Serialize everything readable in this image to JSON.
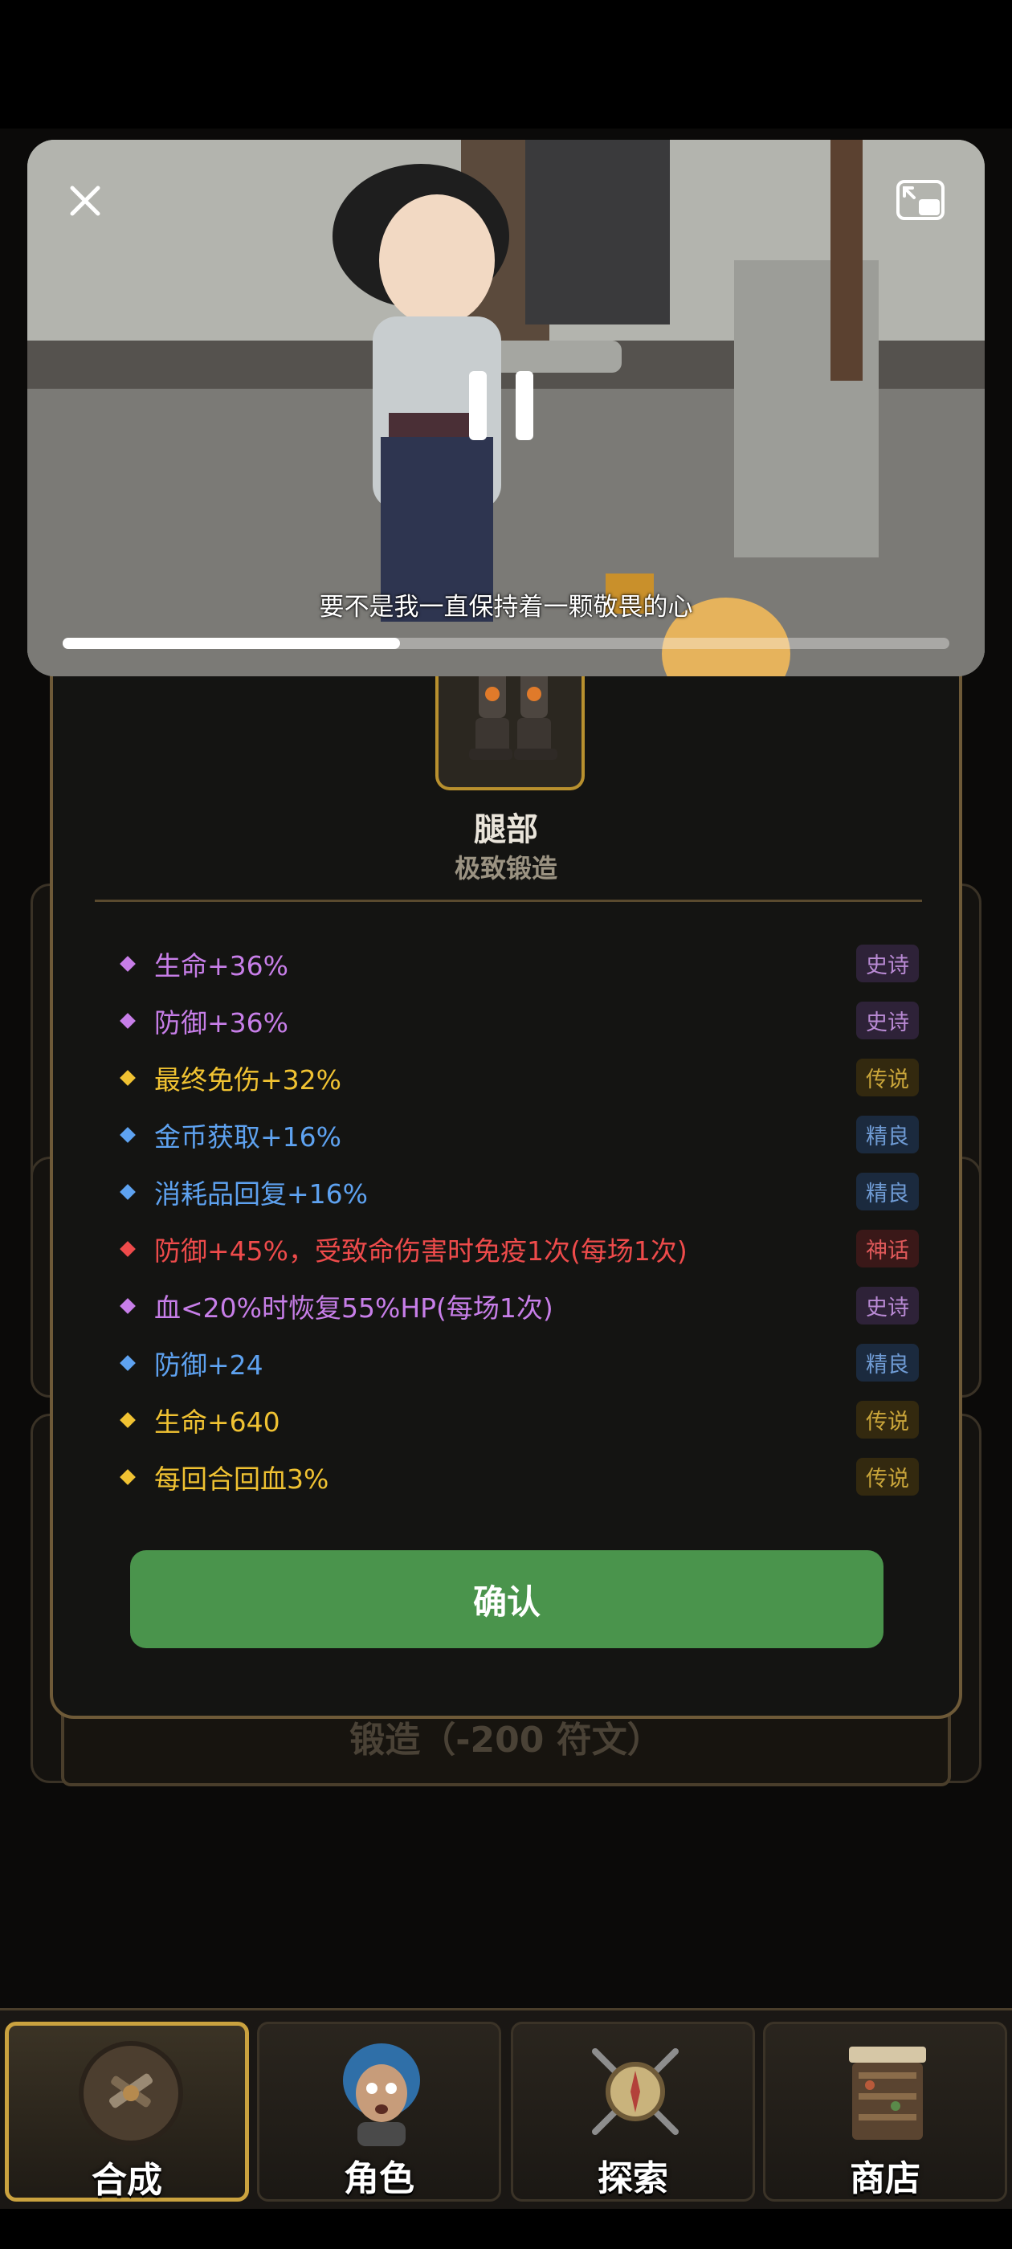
{
  "video": {
    "subtitle": "要不是我一直保持着一颗敬畏的心",
    "progress": 0.38,
    "close_icon": "close-icon",
    "pip_icon": "picture-in-picture-icon",
    "pause_icon": "pause-icon"
  },
  "background": {
    "forge_button_label": "锻造（-200 符文）"
  },
  "modal": {
    "item_name": "腿部",
    "item_subtitle": "极致锻造",
    "confirm_label": "确认",
    "stats": [
      {
        "text": "生命+36%",
        "rarity": "史诗",
        "color": "#c77ee8",
        "badge_bg": "#2e2238",
        "badge_fg": "#b98ad4"
      },
      {
        "text": "防御+36%",
        "rarity": "史诗",
        "color": "#c77ee8",
        "badge_bg": "#2e2238",
        "badge_fg": "#b98ad4"
      },
      {
        "text": "最终免伤+32%",
        "rarity": "传说",
        "color": "#f0c232",
        "badge_bg": "#33290f",
        "badge_fg": "#c9a53a"
      },
      {
        "text": "金币获取+16%",
        "rarity": "精良",
        "color": "#5ea2f0",
        "badge_bg": "#1b2a3e",
        "badge_fg": "#6f9bd4"
      },
      {
        "text": "消耗品回复+16%",
        "rarity": "精良",
        "color": "#5ea2f0",
        "badge_bg": "#1b2a3e",
        "badge_fg": "#6f9bd4"
      },
      {
        "text": "防御+45%，受致命伤害时免疫1次(每场1次)",
        "rarity": "神话",
        "color": "#ee4b4b",
        "badge_bg": "#3a1818",
        "badge_fg": "#e0595a"
      },
      {
        "text": "血<20%时恢复55%HP(每场1次)",
        "rarity": "史诗",
        "color": "#c77ee8",
        "badge_bg": "#2e2238",
        "badge_fg": "#b98ad4"
      },
      {
        "text": "防御+24",
        "rarity": "精良",
        "color": "#5ea2f0",
        "badge_bg": "#1b2a3e",
        "badge_fg": "#6f9bd4"
      },
      {
        "text": "生命+640",
        "rarity": "传说",
        "color": "#f0c232",
        "badge_bg": "#33290f",
        "badge_fg": "#c9a53a"
      },
      {
        "text": "每回合回血3%",
        "rarity": "传说",
        "color": "#f0c232",
        "badge_bg": "#33290f",
        "badge_fg": "#c9a53a"
      }
    ]
  },
  "nav": {
    "tabs": [
      {
        "label": "合成",
        "icon": "crafting-tools-icon",
        "active": true
      },
      {
        "label": "角色",
        "icon": "character-portrait-icon",
        "active": false
      },
      {
        "label": "探索",
        "icon": "compass-swords-icon",
        "active": false
      },
      {
        "label": "商店",
        "icon": "shop-shelf-icon",
        "active": false
      }
    ]
  },
  "colors": {
    "accent_gold": "#caa23f",
    "confirm_green": "#4a944c"
  }
}
